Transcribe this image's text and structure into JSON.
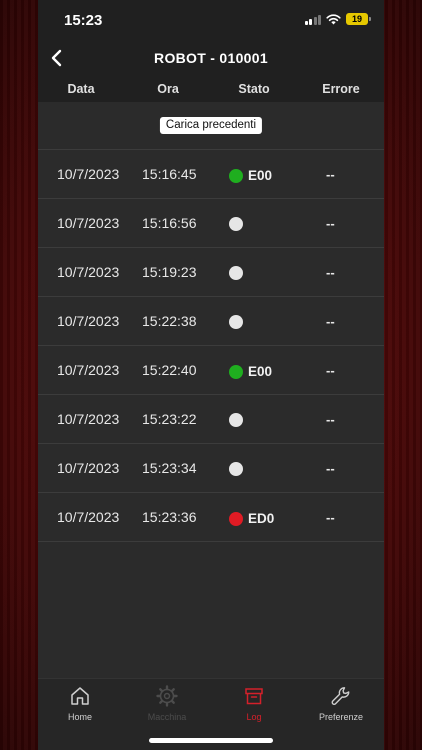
{
  "status_bar": {
    "time": "15:23",
    "battery": "19"
  },
  "header": {
    "title": "ROBOT - 010001"
  },
  "columns": {
    "date": "Data",
    "time": "Ora",
    "state": "Stato",
    "error": "Errore"
  },
  "load_previous_label": "Carica precedenti",
  "rows": [
    {
      "date": "10/7/2023",
      "time": "15:16:45",
      "state_color": "#1fae1f",
      "code": "E00",
      "error": "--"
    },
    {
      "date": "10/7/2023",
      "time": "15:16:56",
      "state_color": "#e6e6e6",
      "code": "",
      "error": "--"
    },
    {
      "date": "10/7/2023",
      "time": "15:19:23",
      "state_color": "#e6e6e6",
      "code": "",
      "error": "--"
    },
    {
      "date": "10/7/2023",
      "time": "15:22:38",
      "state_color": "#e6e6e6",
      "code": "",
      "error": "--"
    },
    {
      "date": "10/7/2023",
      "time": "15:22:40",
      "state_color": "#1fae1f",
      "code": "E00",
      "error": "--"
    },
    {
      "date": "10/7/2023",
      "time": "15:23:22",
      "state_color": "#e6e6e6",
      "code": "",
      "error": "--"
    },
    {
      "date": "10/7/2023",
      "time": "15:23:34",
      "state_color": "#e6e6e6",
      "code": "",
      "error": "--"
    },
    {
      "date": "10/7/2023",
      "time": "15:23:36",
      "state_color": "#e01b24",
      "code": "ED0",
      "error": "--"
    }
  ],
  "tabs": [
    {
      "label": "Home",
      "icon": "home-icon",
      "color": "#cfcfcf"
    },
    {
      "label": "Macchina",
      "icon": "gear-icon",
      "color": "#4c4c4c"
    },
    {
      "label": "Log",
      "icon": "archive-box-icon",
      "color": "#d4202a"
    },
    {
      "label": "Preferenze",
      "icon": "wrench-icon",
      "color": "#cfcfcf"
    }
  ]
}
